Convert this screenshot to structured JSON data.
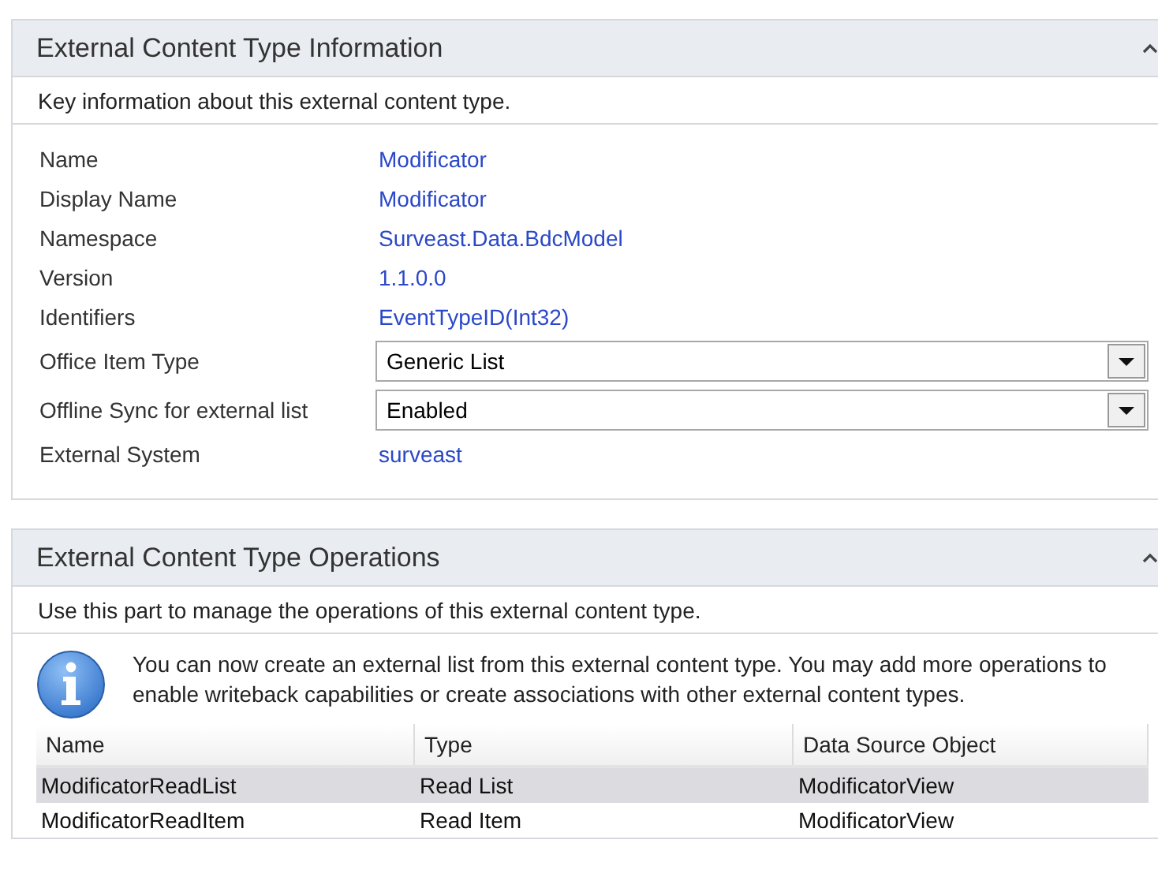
{
  "info_panel": {
    "title": "External Content Type Information",
    "expanded": true,
    "description": "Key information about this external content type.",
    "fields": [
      {
        "label": "Name",
        "kind": "text",
        "value": "Modificator"
      },
      {
        "label": "Display Name",
        "kind": "text",
        "value": "Modificator"
      },
      {
        "label": "Namespace",
        "kind": "text",
        "value": "Surveast.Data.BdcModel"
      },
      {
        "label": "Version",
        "kind": "text",
        "value": "1.1.0.0"
      },
      {
        "label": "Identifiers",
        "kind": "text",
        "value": "EventTypeID(Int32)"
      },
      {
        "label": "Office Item Type",
        "kind": "dropdown",
        "value": "Generic List"
      },
      {
        "label": "Offline Sync for external list",
        "kind": "dropdown",
        "value": "Enabled"
      },
      {
        "label": "External System",
        "kind": "text",
        "value": "surveast"
      }
    ]
  },
  "operations_panel": {
    "title": "External Content Type Operations",
    "expanded": true,
    "description": "Use this part to manage the operations of this external content type.",
    "info_message": "You can now create an external list from this external content type. You may add more operations to enable writeback capabilities or create associations with other external content types.",
    "table": {
      "columns": [
        "Name",
        "Type",
        "Data Source Object"
      ],
      "rows": [
        {
          "cells": [
            "ModificatorReadList",
            "Read List",
            "ModificatorView"
          ],
          "selected": true
        },
        {
          "cells": [
            "ModificatorReadItem",
            "Read Item",
            "ModificatorView"
          ],
          "selected": false
        }
      ]
    }
  }
}
